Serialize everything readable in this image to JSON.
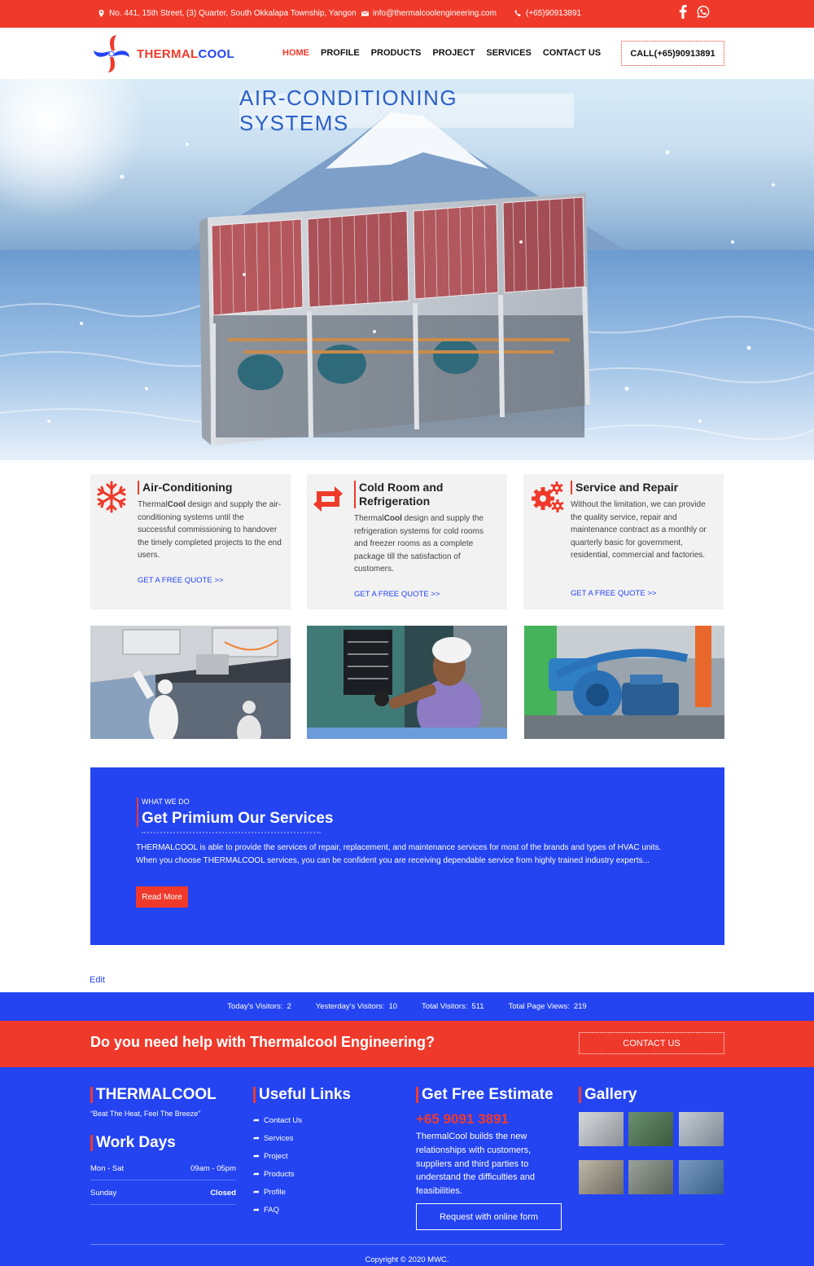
{
  "topbar": {
    "address": "No. 441, 15th Street, (3) Quarter, South Okkalapa Township, Yangon",
    "email": "info@thermalcoolengineering.com",
    "phone": "(+65)90913891"
  },
  "logo": {
    "part1": "THERMAL",
    "part2": "COOL"
  },
  "nav": {
    "items": [
      "HOME",
      "PROFILE",
      "PRODUCTS",
      "PROJECT",
      "SERVICES",
      "CONTACT US"
    ],
    "call_label": "CALL(+65)90913891"
  },
  "hero": {
    "title": "AIR-CONDITIONING SYSTEMS"
  },
  "services": [
    {
      "title": "Air-Conditioning",
      "brand_pre": "Thermal",
      "brand_bold": "Cool",
      "text": " design and supply the air-conditioning systems until the successful commissioning to handover the timely completed projects to the end users.",
      "link": "GET A FREE QUOTE >>"
    },
    {
      "title": "Cold Room and Refrigeration",
      "brand_pre": "Thermal",
      "brand_bold": "Cool",
      "text": " design and supply the refrigeration systems for cold rooms and freezer rooms as a complete package till the satisfaction of customers.",
      "link": "GET A FREE QUOTE >>"
    },
    {
      "title": "Service and Repair",
      "text": "Without the limitation, we can provide the quality service, repair and maintenance contract as a monthly or quarterly basic for government, residential, commercial and factories.",
      "link": "GET A FREE QUOTE >>"
    }
  ],
  "what_we_do": {
    "kicker": "WHAT WE DO",
    "title": "Get Primium Our Services",
    "text": "THERMALCOOL is able to provide the services of repair, replacement, and maintenance services for most of the brands and types of HVAC units. When you choose THERMALCOOL services, you can be confident you are receiving dependable service from highly trained industry experts...",
    "button": "Read More"
  },
  "edit_link": "Edit",
  "visitors": [
    {
      "label": "Today's Visitors:",
      "value": "2"
    },
    {
      "label": "Yesterday's Visitors:",
      "value": "10"
    },
    {
      "label": "Total Visitors:",
      "value": "511"
    },
    {
      "label": "Total Page Views:",
      "value": "219"
    }
  ],
  "cta": {
    "title": "Do you need help with Thermalcool Engineering?",
    "button": "CONTACT US"
  },
  "footer": {
    "brand_title": "THERMALCOOL",
    "tagline": "“Beat The Heat, Feel The Breeze”",
    "work_days_title": "Work Days",
    "work_days": [
      {
        "day": "Mon - Sat",
        "hours": "09am - 05pm"
      },
      {
        "day": "Sunday",
        "hours": "Closed"
      }
    ],
    "links_title": "Useful Links",
    "links": [
      "Contact Us",
      "Services",
      "Project",
      "Products",
      "Profile",
      "FAQ"
    ],
    "estimate_title": "Get Free Estimate",
    "estimate_phone": "+65 9091 3891",
    "estimate_text": "ThermalCool builds the new relationships with customers, suppliers and third parties to understand the difficulties and feasibilities.",
    "estimate_button": "Request with online form",
    "gallery_title": "Gallery",
    "copyright": "Copyright © 2020 MWC."
  },
  "colors": {
    "brand_red": "#ef3a2b",
    "brand_blue": "#2444f2"
  }
}
